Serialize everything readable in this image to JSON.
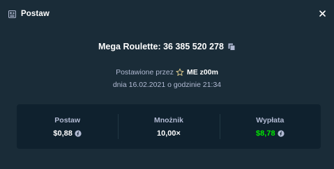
{
  "header": {
    "title": "Postaw",
    "icon": "receipt-icon",
    "close_icon": "close-icon"
  },
  "bet": {
    "game": "Mega Roulette",
    "id": "36 385 520 278",
    "title": "Mega Roulette: 36 385 520 278",
    "copy_icon": "copy-icon"
  },
  "placed": {
    "prefix": "Postawione przez",
    "vip_icon": "star-icon",
    "username": "ME z00m",
    "date_line": "dnia 16.02.2021 o godzinie 21:34"
  },
  "stats": {
    "bet_label": "Postaw",
    "bet_value": "$0,88",
    "multiplier_label": "Mnożnik",
    "multiplier_value": "10,00×",
    "payout_label": "Wypłata",
    "payout_value": "$8,78",
    "currency_icon": "coin-icon"
  },
  "colors": {
    "background": "#1a2c38",
    "panel": "#0f212e",
    "text_primary": "#ffffff",
    "text_secondary": "#b1bad3",
    "win_green": "#00e701"
  }
}
